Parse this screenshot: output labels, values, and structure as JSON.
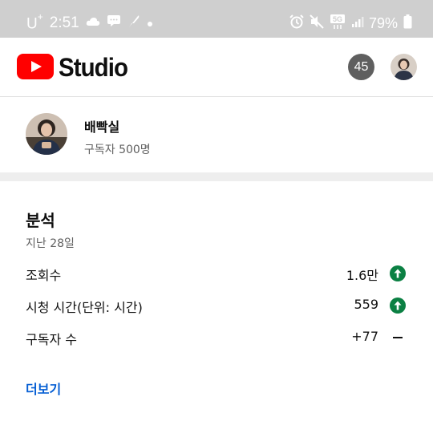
{
  "status_bar": {
    "carrier": "U",
    "carrier_sup": "+",
    "time": "2:51",
    "battery_percent": "79%",
    "network": "5G",
    "icons_left": [
      "cloud-icon",
      "message-icon",
      "feather-icon",
      "dot-icon"
    ],
    "icons_right": [
      "alarm-icon",
      "mute-icon",
      "5g-icon",
      "signal-icon",
      "battery-icon"
    ]
  },
  "header": {
    "logo_word": "Studio",
    "notification_count": "45",
    "brand_color": "#ff0000"
  },
  "channel": {
    "name": "배빡실",
    "subscribers": "구독자 500명"
  },
  "analytics": {
    "title": "분석",
    "period": "지난 28일",
    "metrics": [
      {
        "label": "조회수",
        "value": "1.6만",
        "trend": "up"
      },
      {
        "label": "시청 시간(단위: 시간)",
        "value": "559",
        "trend": "up"
      },
      {
        "label": "구독자 수",
        "value": "+77",
        "trend": "flat"
      }
    ],
    "see_more": "더보기",
    "up_color": "#0b8043",
    "link_color": "#065fd4"
  }
}
